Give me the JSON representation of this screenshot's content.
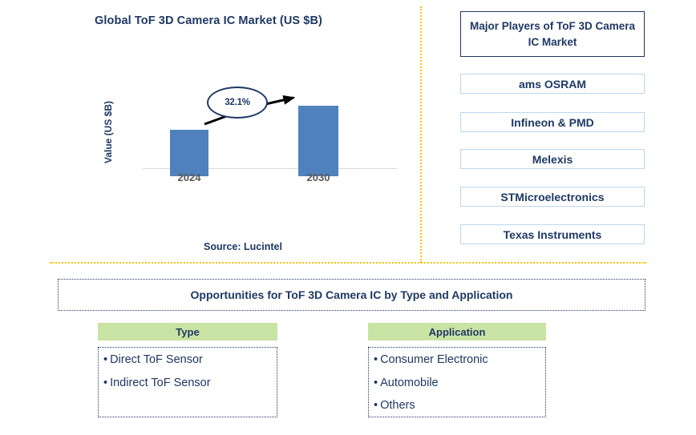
{
  "chart_panel": {
    "title": "Global ToF 3D Camera IC Market (US $B)",
    "y_axis_title": "Value (US $B)",
    "source": "Source: Lucintel"
  },
  "chart_data": {
    "type": "bar",
    "title": "Global ToF 3D Camera IC Market (US $B)",
    "categories": [
      "2024",
      "2030"
    ],
    "values": [
      58,
      88
    ],
    "bar_color": "#4F81BD",
    "xlabel": "",
    "ylabel": "Value (US $B)",
    "grid": false,
    "legend": "none",
    "annotations": [
      {
        "type": "cagr-callout",
        "label": "32.1%",
        "from_category": "2024",
        "to_category": "2030",
        "shape": "ellipse",
        "border_color": "#1F3864"
      }
    ],
    "axis_line_color": "#D9D9D9",
    "tick_label_color": "#595959"
  },
  "players_panel": {
    "header": "Major Players of ToF 3D Camera IC Market",
    "items": [
      {
        "label": "ams OSRAM"
      },
      {
        "label": "Infineon & PMD"
      },
      {
        "label": "Melexis"
      },
      {
        "label": "STMicroelectronics"
      },
      {
        "label": "Texas Instruments"
      }
    ]
  },
  "opportunities": {
    "title": "Opportunities for ToF 3D Camera IC by Type and Application",
    "columns": [
      {
        "header": "Type",
        "items": [
          "Direct ToF Sensor",
          "Indirect ToF Sensor"
        ]
      },
      {
        "header": "Application",
        "items": [
          "Consumer Electronic",
          "Automobile",
          "Others"
        ]
      }
    ],
    "bullet_glyph": "•"
  },
  "theme": {
    "navy": "#1F3864",
    "bar_blue": "#4F81BD",
    "divider_orange": "#FFC000",
    "header_green": "#C9E3A4",
    "box_border_light_blue": "#BDD7EE"
  }
}
